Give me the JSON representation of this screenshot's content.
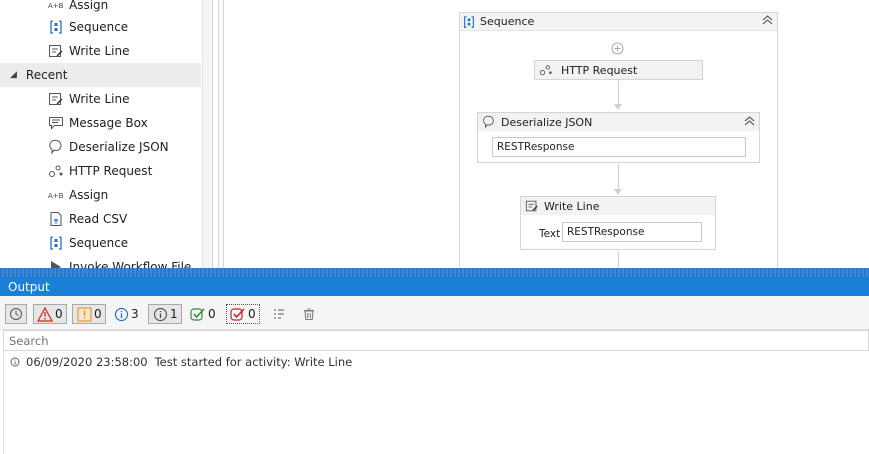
{
  "activities_panel": {
    "items_top": [
      {
        "label": "Assign",
        "icon": "assign-icon"
      },
      {
        "label": "Sequence",
        "icon": "sequence-icon"
      },
      {
        "label": "Write Line",
        "icon": "write-line-icon"
      }
    ],
    "recent_label": "Recent",
    "recent_items": [
      {
        "label": "Write Line",
        "icon": "write-line-icon"
      },
      {
        "label": "Message Box",
        "icon": "message-box-icon"
      },
      {
        "label": "Deserialize JSON",
        "icon": "deserialize-json-icon"
      },
      {
        "label": "HTTP Request",
        "icon": "http-request-icon"
      },
      {
        "label": "Assign",
        "icon": "assign-icon"
      },
      {
        "label": "Read CSV",
        "icon": "read-csv-icon"
      },
      {
        "label": "Sequence",
        "icon": "sequence-icon"
      },
      {
        "label": "Invoke Workflow File",
        "icon": "invoke-workflow-icon"
      }
    ]
  },
  "designer": {
    "sequence_title": "Sequence",
    "http_request_title": "HTTP Request",
    "deserialize_title": "Deserialize JSON",
    "deserialize_value": "RESTResponse",
    "write_line_title": "Write Line",
    "write_line_text_label": "Text",
    "write_line_text_value": "RESTResponse"
  },
  "output": {
    "title": "Output",
    "filters": [
      {
        "name": "timestamp-toggle",
        "count": ""
      },
      {
        "name": "errors",
        "count": "0"
      },
      {
        "name": "warnings",
        "count": "0"
      },
      {
        "name": "info",
        "count": "3"
      },
      {
        "name": "trace",
        "count": "1"
      },
      {
        "name": "passed",
        "count": "0"
      },
      {
        "name": "failed",
        "count": "0"
      }
    ],
    "search_placeholder": "Search",
    "log": [
      {
        "timestamp": "06/09/2020 23:58:00",
        "message": "Test started for activity: Write Line"
      }
    ]
  }
}
